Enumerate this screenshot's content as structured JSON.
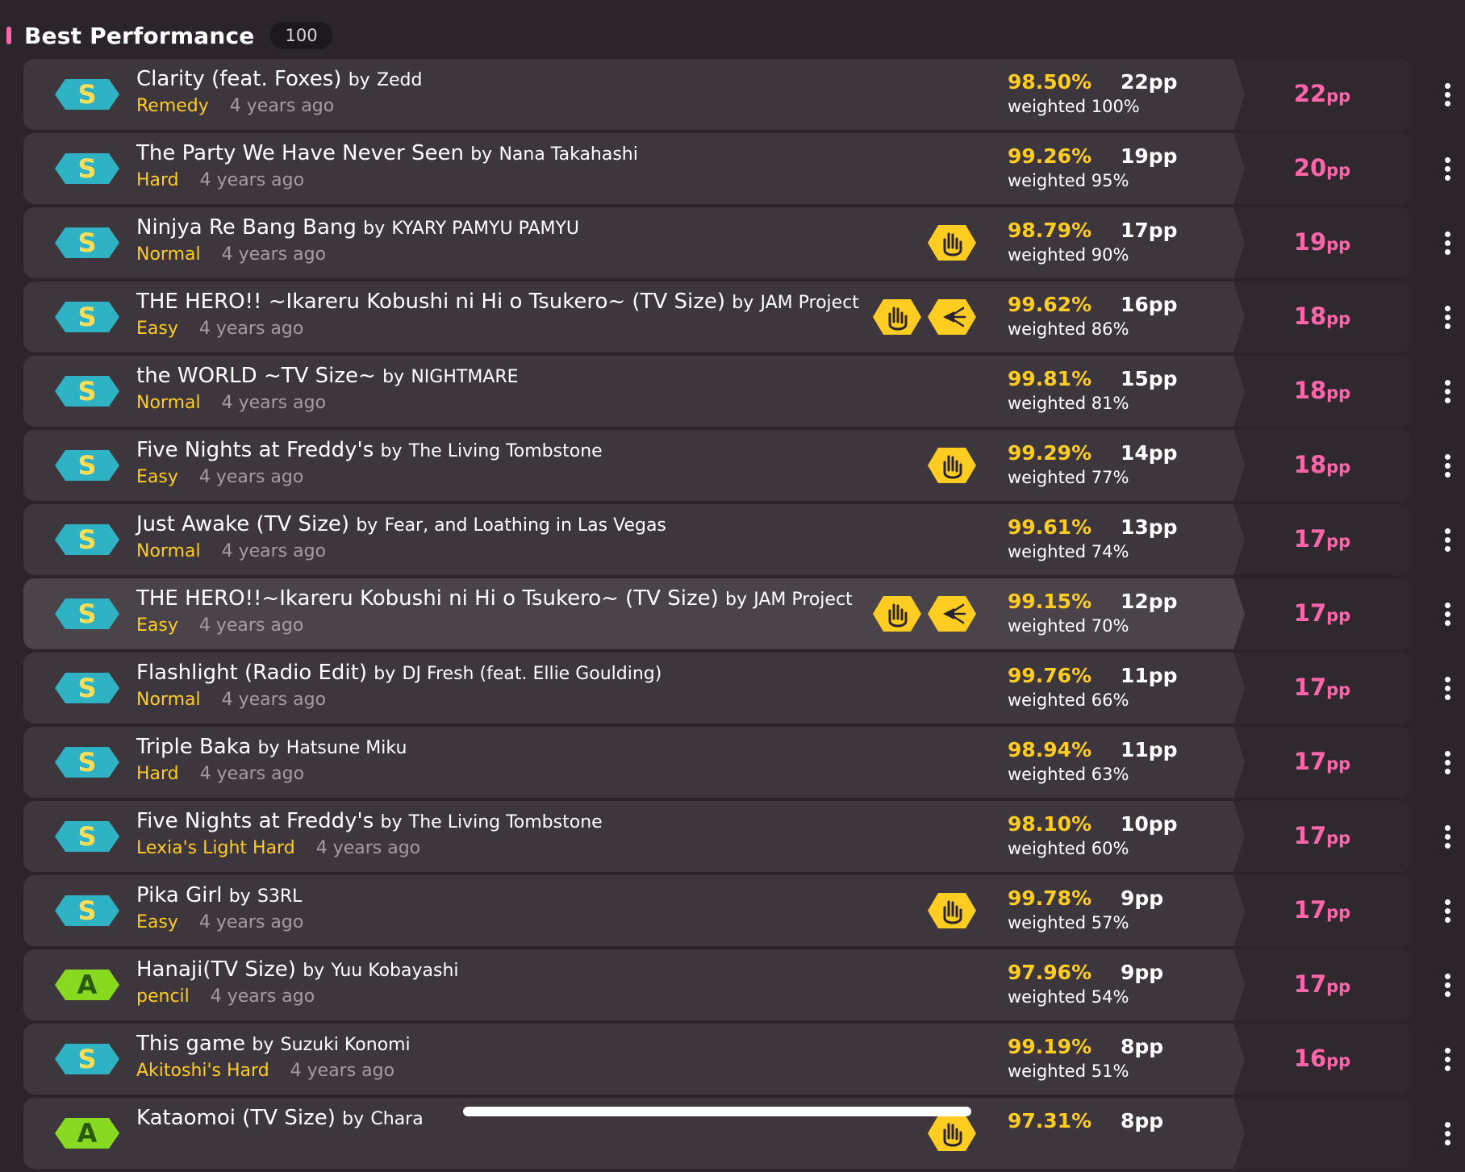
{
  "section": {
    "title": "Best Performance",
    "count": "100"
  },
  "colors": {
    "accent": "#ff66aa",
    "accuracy": "#ffcc22",
    "rank_s": "#2fb2c4",
    "rank_a": "#88da20",
    "mod": "#ffcc22"
  },
  "scores": [
    {
      "title": "Clarity (feat. Foxes)",
      "by": "by",
      "artist": "Zedd",
      "difficulty": "Remedy",
      "time": "4 years ago",
      "accuracy": "98.50%",
      "pp": "22pp",
      "weighted": "weighted 100%",
      "weighted_pp": "22",
      "unit": "pp",
      "rank": "S",
      "mods": []
    },
    {
      "title": "The Party We Have Never Seen",
      "by": "by",
      "artist": "Nana Takahashi",
      "difficulty": "Hard",
      "time": "4 years ago",
      "accuracy": "99.26%",
      "pp": "19pp",
      "weighted": "weighted 95%",
      "weighted_pp": "20",
      "unit": "pp",
      "rank": "S",
      "mods": []
    },
    {
      "title": "Ninjya Re Bang Bang",
      "by": "by",
      "artist": "KYARY PAMYU PAMYU",
      "difficulty": "Normal",
      "time": "4 years ago",
      "accuracy": "98.79%",
      "pp": "17pp",
      "weighted": "weighted 90%",
      "weighted_pp": "19",
      "unit": "pp",
      "rank": "S",
      "mods": [
        "hidden-hand-icon"
      ]
    },
    {
      "title": "THE HERO!! ~Ikareru Kobushi ni Hi o Tsukero~ (TV Size)",
      "by": "by",
      "artist": "JAM Project",
      "difficulty": "Easy",
      "time": "4 years ago",
      "accuracy": "99.62%",
      "pp": "16pp",
      "weighted": "weighted 86%",
      "weighted_pp": "18",
      "unit": "pp",
      "rank": "S",
      "mods": [
        "hidden-hand-icon",
        "flashlight-icon"
      ]
    },
    {
      "title": "the WORLD ~TV Size~",
      "by": "by",
      "artist": "NIGHTMARE",
      "difficulty": "Normal",
      "time": "4 years ago",
      "accuracy": "99.81%",
      "pp": "15pp",
      "weighted": "weighted 81%",
      "weighted_pp": "18",
      "unit": "pp",
      "rank": "S",
      "mods": []
    },
    {
      "title": "Five Nights at Freddy's",
      "by": "by",
      "artist": "The Living Tombstone",
      "difficulty": "Easy",
      "time": "4 years ago",
      "accuracy": "99.29%",
      "pp": "14pp",
      "weighted": "weighted 77%",
      "weighted_pp": "18",
      "unit": "pp",
      "rank": "S",
      "mods": [
        "hidden-hand-icon"
      ]
    },
    {
      "title": "Just Awake (TV Size)",
      "by": "by",
      "artist": "Fear, and Loathing in Las Vegas",
      "difficulty": "Normal",
      "time": "4 years ago",
      "accuracy": "99.61%",
      "pp": "13pp",
      "weighted": "weighted 74%",
      "weighted_pp": "17",
      "unit": "pp",
      "rank": "S",
      "mods": []
    },
    {
      "title": "THE HERO!!~Ikareru Kobushi ni Hi o Tsukero~ (TV Size)",
      "by": "by",
      "artist": "JAM Project",
      "difficulty": "Easy",
      "time": "4 years ago",
      "accuracy": "99.15%",
      "pp": "12pp",
      "weighted": "weighted 70%",
      "weighted_pp": "17",
      "unit": "pp",
      "rank": "S",
      "mods": [
        "hidden-hand-icon",
        "flashlight-icon"
      ],
      "highlighted": true
    },
    {
      "title": "Flashlight (Radio Edit)",
      "by": "by",
      "artist": "DJ Fresh (feat. Ellie Goulding)",
      "difficulty": "Normal",
      "time": "4 years ago",
      "accuracy": "99.76%",
      "pp": "11pp",
      "weighted": "weighted 66%",
      "weighted_pp": "17",
      "unit": "pp",
      "rank": "S",
      "mods": []
    },
    {
      "title": "Triple Baka",
      "by": "by",
      "artist": "Hatsune Miku",
      "difficulty": "Hard",
      "time": "4 years ago",
      "accuracy": "98.94%",
      "pp": "11pp",
      "weighted": "weighted 63%",
      "weighted_pp": "17",
      "unit": "pp",
      "rank": "S",
      "mods": []
    },
    {
      "title": "Five Nights at Freddy's",
      "by": "by",
      "artist": "The Living Tombstone",
      "difficulty": "Lexia's Light Hard",
      "time": "4 years ago",
      "accuracy": "98.10%",
      "pp": "10pp",
      "weighted": "weighted 60%",
      "weighted_pp": "17",
      "unit": "pp",
      "rank": "S",
      "mods": []
    },
    {
      "title": "Pika Girl",
      "by": "by",
      "artist": "S3RL",
      "difficulty": "Easy",
      "time": "4 years ago",
      "accuracy": "99.78%",
      "pp": "9pp",
      "weighted": "weighted 57%",
      "weighted_pp": "17",
      "unit": "pp",
      "rank": "S",
      "mods": [
        "hidden-hand-icon"
      ]
    },
    {
      "title": "Hanaji(TV Size)",
      "by": "by",
      "artist": "Yuu Kobayashi",
      "difficulty": "pencil",
      "time": "4 years ago",
      "accuracy": "97.96%",
      "pp": "9pp",
      "weighted": "weighted 54%",
      "weighted_pp": "17",
      "unit": "pp",
      "rank": "A",
      "mods": []
    },
    {
      "title": "This game",
      "by": "by",
      "artist": "Suzuki Konomi",
      "difficulty": "Akitoshi's Hard",
      "time": "4 years ago",
      "accuracy": "99.19%",
      "pp": "8pp",
      "weighted": "weighted 51%",
      "weighted_pp": "16",
      "unit": "pp",
      "rank": "S",
      "mods": []
    },
    {
      "title": "Kataomoi (TV Size)",
      "by": "by",
      "artist": "Chara",
      "difficulty": "",
      "time": "",
      "accuracy": "97.31%",
      "pp": "8pp",
      "weighted": "",
      "weighted_pp": "",
      "unit": "",
      "rank": "A",
      "mods": [
        "hidden-hand-icon"
      ]
    }
  ]
}
